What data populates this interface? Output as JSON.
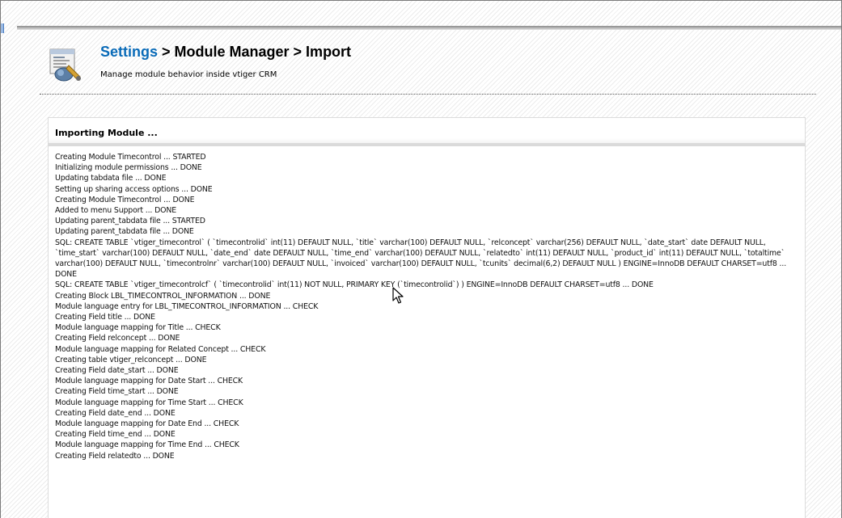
{
  "header": {
    "breadcrumb_link": "Settings",
    "breadcrumb_rest": " > Module Manager > Import",
    "subtitle": "Manage module behavior inside vtiger CRM"
  },
  "panel": {
    "title": "Importing Module ..."
  },
  "log": [
    "Creating Module Timecontrol ... STARTED",
    "Initializing module permissions ... DONE",
    "Updating tabdata file ... DONE",
    "Setting up sharing access options ... DONE",
    "Creating Module Timecontrol ... DONE",
    "Added to menu Support ... DONE",
    "Updating parent_tabdata file ... STARTED",
    "Updating parent_tabdata file ... DONE",
    "SQL: CREATE TABLE `vtiger_timecontrol` ( `timecontrolid` int(11) DEFAULT NULL, `title` varchar(100) DEFAULT NULL, `relconcept` varchar(256) DEFAULT NULL, `date_start` date DEFAULT NULL, `time_start` varchar(100) DEFAULT NULL, `date_end` date DEFAULT NULL, `time_end` varchar(100) DEFAULT NULL, `relatedto` int(11) DEFAULT NULL, `product_id` int(11) DEFAULT NULL, `totaltime` varchar(100) DEFAULT NULL, `timecontrolnr` varchar(100) DEFAULT NULL, `invoiced` varchar(100) DEFAULT NULL, `tcunits` decimal(6,2) DEFAULT NULL ) ENGINE=InnoDB DEFAULT CHARSET=utf8 ... DONE",
    "SQL: CREATE TABLE `vtiger_timecontrolcf` ( `timecontrolid` int(11) NOT NULL, PRIMARY KEY (`timecontrolid`) ) ENGINE=InnoDB DEFAULT CHARSET=utf8 ... DONE",
    "Creating Block LBL_TIMECONTROL_INFORMATION ... DONE",
    "Module language entry for LBL_TIMECONTROL_INFORMATION ... CHECK",
    "Creating Field title ... DONE",
    "Module language mapping for Title ... CHECK",
    "Creating Field relconcept ... DONE",
    "Module language mapping for Related Concept ... CHECK",
    "Creating table vtiger_relconcept ... DONE",
    "Creating Field date_start ... DONE",
    "Module language mapping for Date Start ... CHECK",
    "Creating Field time_start ... DONE",
    "Module language mapping for Time Start ... CHECK",
    "Creating Field date_end ... DONE",
    "Module language mapping for Date End ... CHECK",
    "Creating Field time_end ... DONE",
    "Module language mapping for Time End ... CHECK",
    "Creating Field relatedto ... DONE"
  ]
}
